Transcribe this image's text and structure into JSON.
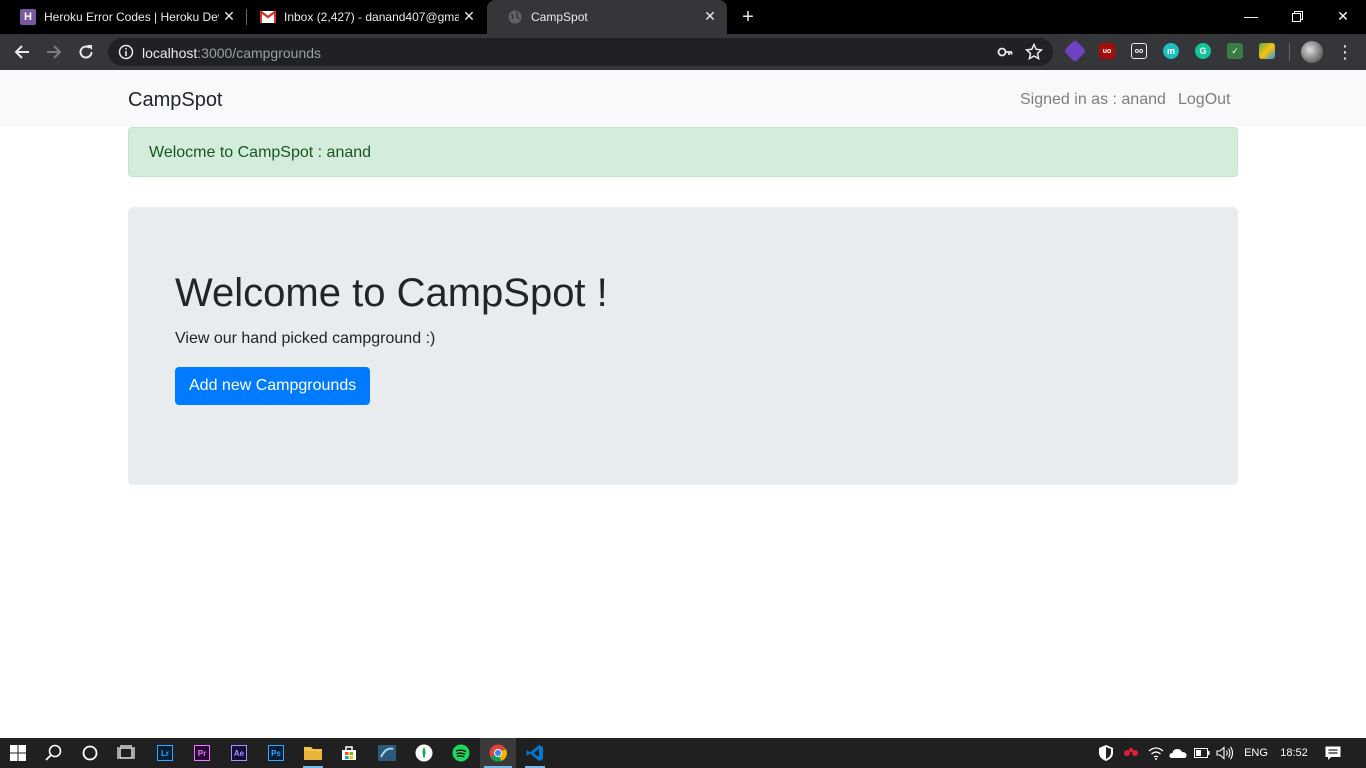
{
  "browser": {
    "tabs": [
      {
        "title": "Heroku Error Codes | Heroku Dev",
        "favicon": "heroku-icon"
      },
      {
        "title": "Inbox (2,427) - danand407@gma",
        "favicon": "gmail-icon"
      },
      {
        "title": "CampSpot",
        "favicon": "globe-icon",
        "active": true
      }
    ],
    "url_host": "localhost",
    "url_path": ":3000/campgrounds"
  },
  "navbar": {
    "brand": "CampSpot",
    "signed_in": "Signed in as : anand",
    "logout": "LogOut"
  },
  "alert": {
    "message": "Welocme to CampSpot : anand",
    "color": "#d4edda"
  },
  "jumbotron": {
    "title": "Welcome to CampSpot !",
    "lead": "View our hand picked campground :)",
    "button": "Add new Campgrounds",
    "button_color": "#007bff"
  },
  "taskbar": {
    "apps": [
      "Lr",
      "Pr",
      "Ae",
      "Ps"
    ],
    "language": "ENG",
    "time": "18:52"
  }
}
